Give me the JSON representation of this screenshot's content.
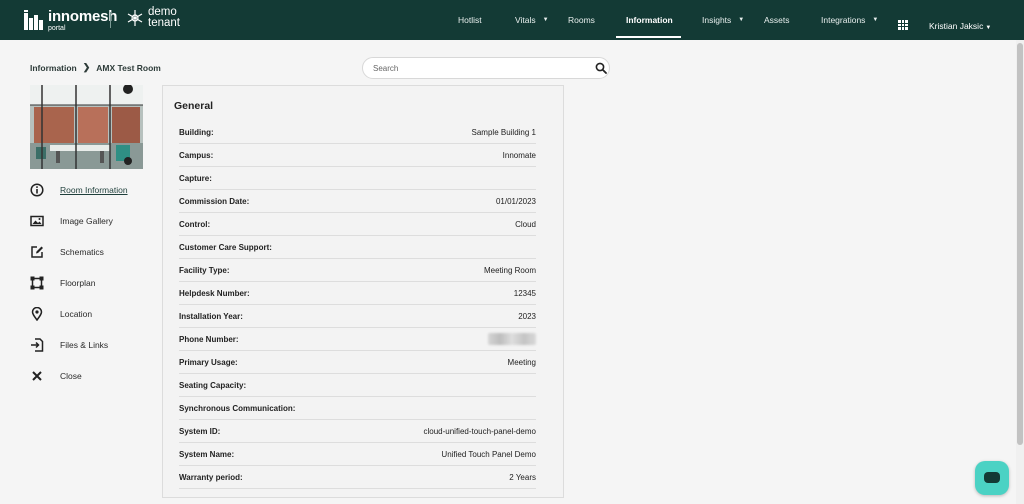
{
  "header": {
    "brand": "innomesh",
    "brand_sub": "portal",
    "tenant_line1": "demo",
    "tenant_line2": "tenant",
    "nav": [
      {
        "label": "Hotlist"
      },
      {
        "label": "Vitals"
      },
      {
        "label": "Rooms"
      },
      {
        "label": "Information"
      },
      {
        "label": "Insights"
      },
      {
        "label": "Assets"
      },
      {
        "label": "Integrations"
      }
    ],
    "active_nav": "Information",
    "user_name": "Kristian Jaksic"
  },
  "breadcrumb": {
    "parent": "Information",
    "current": "AMX Test Room"
  },
  "search": {
    "placeholder": "Search",
    "value": ""
  },
  "side_menu": [
    {
      "label": "Room Information",
      "icon": "info-icon"
    },
    {
      "label": "Image Gallery",
      "icon": "image-icon"
    },
    {
      "label": "Schematics",
      "icon": "edit-icon"
    },
    {
      "label": "Floorplan",
      "icon": "floorplan-icon"
    },
    {
      "label": "Location",
      "icon": "location-pin-icon"
    },
    {
      "label": "Files & Links",
      "icon": "file-link-icon"
    },
    {
      "label": "Close",
      "icon": "close-icon"
    }
  ],
  "general": {
    "title": "General",
    "rows": [
      {
        "label": "Building:",
        "value": "Sample Building 1"
      },
      {
        "label": "Campus:",
        "value": "Innomate"
      },
      {
        "label": "Capture:",
        "value": ""
      },
      {
        "label": "Commission Date:",
        "value": "01/01/2023"
      },
      {
        "label": "Control:",
        "value": "Cloud"
      },
      {
        "label": "Customer Care Support:",
        "value": ""
      },
      {
        "label": "Facility Type:",
        "value": "Meeting Room"
      },
      {
        "label": "Helpdesk Number:",
        "value": "12345"
      },
      {
        "label": "Installation Year:",
        "value": "2023"
      },
      {
        "label": "Phone Number:",
        "value": ""
      },
      {
        "label": "Primary Usage:",
        "value": "Meeting"
      },
      {
        "label": "Seating Capacity:",
        "value": ""
      },
      {
        "label": "Synchronous Communication:",
        "value": ""
      },
      {
        "label": "System ID:",
        "value": "cloud-unified-touch-panel-demo"
      },
      {
        "label": "System Name:",
        "value": "Unified Touch Panel Demo"
      },
      {
        "label": "Warranty period:",
        "value": "2 Years"
      }
    ]
  },
  "colors": {
    "header_bg": "#133a35",
    "chat_button": "#4bd2c4"
  }
}
